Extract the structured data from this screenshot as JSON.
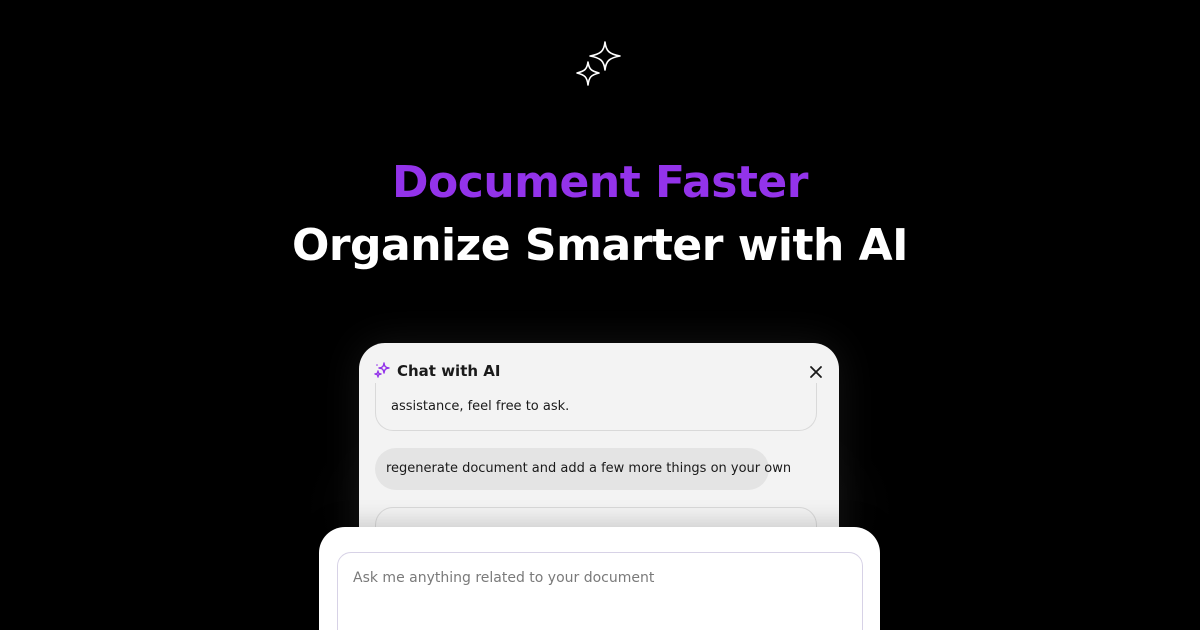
{
  "hero": {
    "icon": "sparkles-icon",
    "headline_accent": "Document Faster",
    "headline_main": "Organize Smarter with AI",
    "accent_color": "#9333ea"
  },
  "chat": {
    "header_icon": "sparkles-icon",
    "title": "Chat with AI",
    "close_icon": "close-icon",
    "messages": [
      {
        "role": "assistant",
        "text": "assistance, feel free to ask."
      },
      {
        "role": "user",
        "text": "regenerate document and add a few more things on your own"
      },
      {
        "role": "assistant",
        "text": ""
      }
    ]
  },
  "composer": {
    "placeholder": "Ask me anything related to your document"
  }
}
